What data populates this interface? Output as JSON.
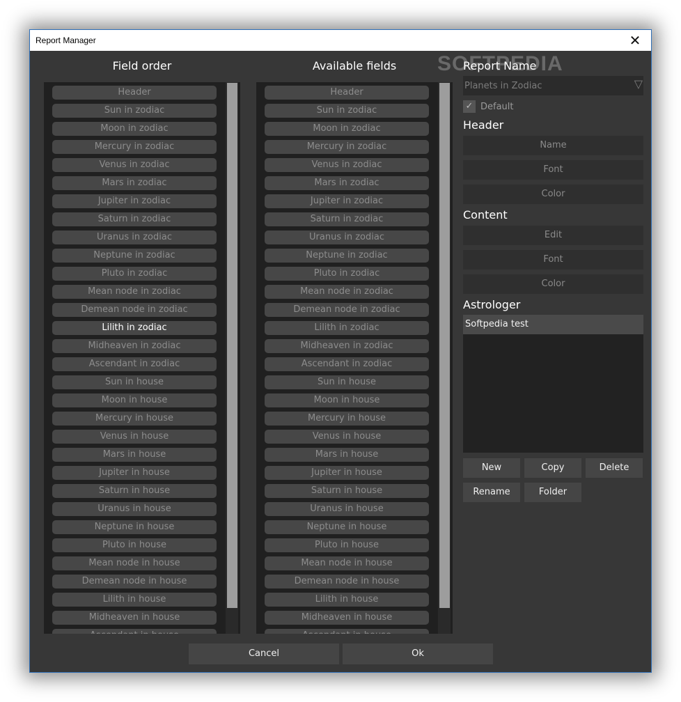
{
  "window": {
    "title": "Report Manager",
    "close_symbol": "✕"
  },
  "watermark": "SOFTPEDIA",
  "field_order": {
    "title": "Field order",
    "items": [
      "Header",
      "Sun in zodiac",
      "Moon in zodiac",
      "Mercury in zodiac",
      "Venus in zodiac",
      "Mars in zodiac",
      "Jupiter in zodiac",
      "Saturn in zodiac",
      "Uranus in zodiac",
      "Neptune in zodiac",
      "Pluto in zodiac",
      "Mean node in zodiac",
      "Demean node in zodiac",
      "Lilith in zodiac",
      "Midheaven in zodiac",
      "Ascendant in zodiac",
      "Sun in house",
      "Moon in house",
      "Mercury in house",
      "Venus in house",
      "Mars in house",
      "Jupiter in house",
      "Saturn in house",
      "Uranus in house",
      "Neptune in house",
      "Pluto in house",
      "Mean node in house",
      "Demean node in house",
      "Lilith in house",
      "Midheaven in house",
      "Ascendant in house"
    ],
    "selected": "Lilith in zodiac"
  },
  "available_fields": {
    "title": "Available fields",
    "items": [
      "Header",
      "Sun in zodiac",
      "Moon in zodiac",
      "Mercury in zodiac",
      "Venus in zodiac",
      "Mars in zodiac",
      "Jupiter in zodiac",
      "Saturn in zodiac",
      "Uranus in zodiac",
      "Neptune in zodiac",
      "Pluto in zodiac",
      "Mean node in zodiac",
      "Demean node in zodiac",
      "Lilith in zodiac",
      "Midheaven in zodiac",
      "Ascendant in zodiac",
      "Sun in house",
      "Moon in house",
      "Mercury in house",
      "Venus in house",
      "Mars in house",
      "Jupiter in house",
      "Saturn in house",
      "Uranus in house",
      "Neptune in house",
      "Pluto in house",
      "Mean node in house",
      "Demean node in house",
      "Lilith in house",
      "Midheaven in house",
      "Ascendant in house"
    ]
  },
  "report_name": {
    "label": "Report Name",
    "value": "Planets in Zodiac",
    "dropdown_arrow": "▽"
  },
  "default_checkbox": {
    "label": "Default",
    "checked": true,
    "mark": "✓"
  },
  "header_section": {
    "label": "Header",
    "name_button": "Name",
    "font_button": "Font",
    "color_button": "Color"
  },
  "content_section": {
    "label": "Content",
    "edit_button": "Edit",
    "font_button": "Font",
    "color_button": "Color"
  },
  "astrologer": {
    "label": "Astrologer",
    "items": [
      "Softpedia test"
    ]
  },
  "actions": {
    "new": "New",
    "copy": "Copy",
    "delete": "Delete",
    "rename": "Rename",
    "folder": "Folder"
  },
  "footer": {
    "cancel": "Cancel",
    "ok": "Ok"
  },
  "colors": {
    "window_bg": "#373737",
    "list_bg": "#202020",
    "item_bg": "#474747",
    "item_text": "#8c8c8c",
    "selected_text": "#ffffff",
    "title_bar_border": "#2f6fb7"
  }
}
